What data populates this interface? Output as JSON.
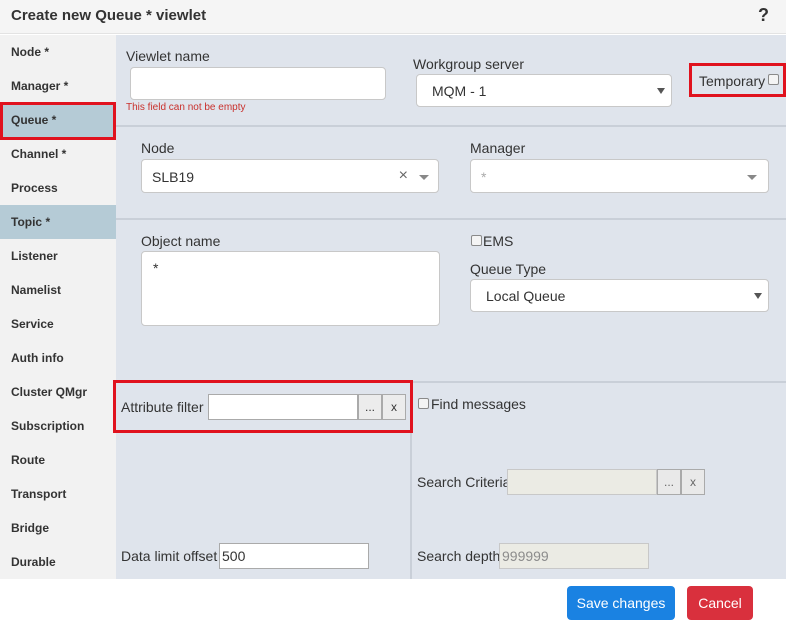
{
  "dialog": {
    "title": "Create new Queue * viewlet",
    "help": "?"
  },
  "sidebar": {
    "items": [
      {
        "label": "Node *"
      },
      {
        "label": "Manager *"
      },
      {
        "label": "Queue *"
      },
      {
        "label": "Channel *"
      },
      {
        "label": "Process"
      },
      {
        "label": "Topic *"
      },
      {
        "label": "Listener"
      },
      {
        "label": "Namelist"
      },
      {
        "label": "Service"
      },
      {
        "label": "Auth info"
      },
      {
        "label": "Cluster QMgr"
      },
      {
        "label": "Subscription"
      },
      {
        "label": "Route"
      },
      {
        "label": "Transport"
      },
      {
        "label": "Bridge"
      },
      {
        "label": "Durable"
      }
    ],
    "selected": "Queue *"
  },
  "form": {
    "viewlet_name_label": "Viewlet name",
    "viewlet_name_value": "",
    "viewlet_name_error": "This field can not be empty",
    "workgroup_label": "Workgroup server",
    "workgroup_value": "MQM - 1",
    "temporary_label": "Temporary",
    "node_label": "Node",
    "node_value": "SLB19",
    "node_clear": "×",
    "manager_label": "Manager",
    "manager_value": "*",
    "object_name_label": "Object name",
    "object_name_value": "*",
    "ems_label": "EMS",
    "queue_type_label": "Queue Type",
    "queue_type_value": "Local Queue",
    "attribute_filter_label": "Attribute filter",
    "attribute_filter_value": "",
    "browse_label": "...",
    "clear_label": "x",
    "find_messages_label": "Find messages",
    "search_criteria_label": "Search Criteria",
    "search_criteria_value": "",
    "data_limit_label": "Data limit offset",
    "data_limit_value": "500",
    "search_depth_label": "Search depth",
    "search_depth_value": "999999"
  },
  "footer": {
    "save_label": "Save changes",
    "cancel_label": "Cancel"
  },
  "colors": {
    "primary": "#1a82e2",
    "danger": "#d9303d",
    "highlight": "#e0121e",
    "selected_bg": "#b5cbd6"
  }
}
